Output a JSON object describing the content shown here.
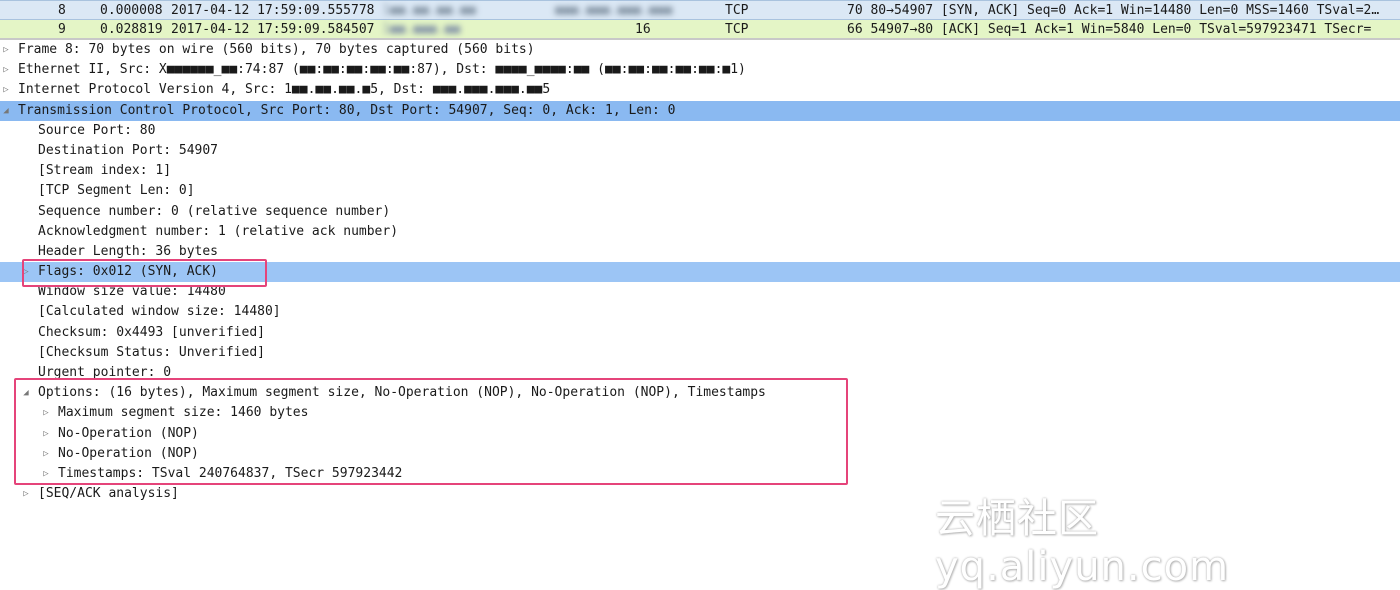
{
  "packet_list": {
    "selected": {
      "no": "8",
      "time": "0.000008",
      "date": "2017-04-12 17:59:09.555778",
      "src": "1■■.■■.■■.■■",
      "dst": "■■■.■■■.■■■.■■■",
      "protocol": "TCP",
      "info": "70 80→54907 [SYN, ACK] Seq=0 Ack=1 Win=14480 Len=0 MSS=1460 TSval=2…"
    },
    "next": {
      "no": "9",
      "time": "0.028819",
      "date": "2017-04-12 17:59:09.584507",
      "src": "1■■.■■■.■■",
      "dst": "16",
      "protocol": "TCP",
      "info": "66 54907→80 [ACK] Seq=1 Ack=1 Win=5840 Len=0 TSval=597923471 TSecr="
    }
  },
  "tree": [
    {
      "level": 0,
      "arrow": "collapsed",
      "text": "Frame 8: 70 bytes on wire (560 bits), 70 bytes captured (560 bits)"
    },
    {
      "level": 0,
      "arrow": "collapsed",
      "text": "Ethernet II, Src: X■■■■■■_■■:74:87 (■■:■■:■■:■■:■■:87), Dst: ■■■■_■■■■:■■ (■■:■■:■■:■■:■■:■1)"
    },
    {
      "level": 0,
      "arrow": "collapsed",
      "text": "Internet Protocol Version 4, Src: 1■■.■■.■■.■5, Dst: ■■■.■■■.■■■.■■5"
    },
    {
      "level": 0,
      "arrow": "expanded",
      "text": "Transmission Control Protocol, Src Port: 80, Dst Port: 54907, Seq: 0, Ack: 1, Len: 0",
      "highlight": "selected"
    },
    {
      "level": 1,
      "text": "Source Port: 80"
    },
    {
      "level": 1,
      "text": "Destination Port: 54907"
    },
    {
      "level": 1,
      "text": "[Stream index: 1]"
    },
    {
      "level": 1,
      "text": "[TCP Segment Len: 0]"
    },
    {
      "level": 1,
      "text": "Sequence number: 0    (relative sequence number)"
    },
    {
      "level": 1,
      "text": "Acknowledgment number: 1    (relative ack number)"
    },
    {
      "level": 1,
      "text": "Header Length: 36 bytes"
    },
    {
      "level": 1,
      "arrow": "collapsed",
      "text": "Flags: 0x012 (SYN, ACK)",
      "highlight": "field"
    },
    {
      "level": 1,
      "text": "Window size value: 14480"
    },
    {
      "level": 1,
      "text": "[Calculated window size: 14480]"
    },
    {
      "level": 1,
      "text": "Checksum: 0x4493 [unverified]"
    },
    {
      "level": 1,
      "text": "[Checksum Status: Unverified]"
    },
    {
      "level": 1,
      "text": "Urgent pointer: 0"
    },
    {
      "level": 1,
      "arrow": "expanded",
      "text": "Options: (16 bytes), Maximum segment size, No-Operation (NOP), No-Operation (NOP), Timestamps"
    },
    {
      "level": 2,
      "arrow": "collapsed",
      "text": "Maximum segment size: 1460 bytes"
    },
    {
      "level": 2,
      "arrow": "collapsed",
      "text": "No-Operation (NOP)"
    },
    {
      "level": 2,
      "arrow": "collapsed",
      "text": "No-Operation (NOP)"
    },
    {
      "level": 2,
      "arrow": "collapsed",
      "text": "Timestamps: TSval 240764837, TSecr 597923442"
    },
    {
      "level": 1,
      "arrow": "collapsed",
      "text": "[SEQ/ACK analysis]"
    }
  ],
  "watermark": "云栖社区 yq.aliyun.com",
  "colors": {
    "selected_row": "#8ab9f1",
    "annotation_box": "#e5447a",
    "next_packet_row": "#e4f5c6"
  }
}
